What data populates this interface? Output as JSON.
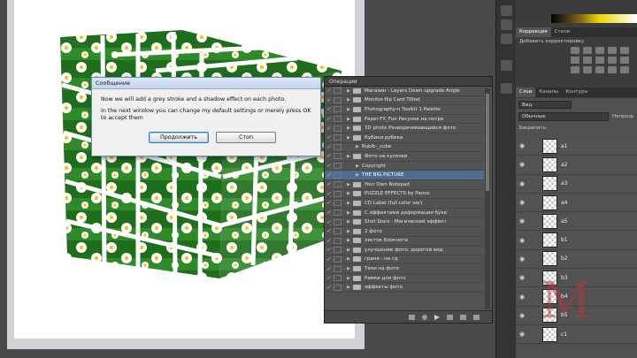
{
  "dialog": {
    "title": "Сообщение",
    "line1": "Now we will add a grey stroke and a shadow effect on each photo.",
    "line2": "In the next window you can change my default settings or merely press OK to accept them",
    "continue_label": "Продолжить",
    "stop_label": "Стоп"
  },
  "actions_panel": {
    "tab": "Операции",
    "rows": [
      {
        "label": "Магазин - Layers Down upgrade Angle",
        "type": "set",
        "sel": false
      },
      {
        "label": "Monitor-flip Card Tilted",
        "type": "set",
        "sel": false
      },
      {
        "label": "Photography-n Toolkit 1 Palette",
        "type": "set",
        "sel": false
      },
      {
        "label": "Paper-FX_Fun Рисунок на потре",
        "type": "set",
        "sel": false
      },
      {
        "label": "3D photo Разворачивающийся фото",
        "type": "set",
        "sel": false
      },
      {
        "label": "Кубики рубика",
        "type": "set",
        "sel": false
      },
      {
        "label": "Rubik-_cube",
        "type": "action",
        "sel": false
      },
      {
        "label": "Фото на кусочки",
        "type": "set",
        "sel": false
      },
      {
        "label": "Copyright",
        "type": "action",
        "sel": false
      },
      {
        "label": "THE BIG PICTURE",
        "type": "action",
        "sel": true
      },
      {
        "label": "Your Own Notepad",
        "type": "set",
        "sel": false
      },
      {
        "label": "PUZZLE EFFECTS by Panos",
        "type": "set",
        "sel": false
      },
      {
        "label": "CD Label (full color ver)",
        "type": "set",
        "sel": false
      },
      {
        "label": "С эффектами деформации букв",
        "type": "set",
        "sel": false
      },
      {
        "label": "Shot Stars - Магический эффект",
        "type": "set",
        "sel": false
      },
      {
        "label": "2 фото",
        "type": "set",
        "sel": false
      },
      {
        "label": "листок блокнота",
        "type": "set",
        "sel": false
      },
      {
        "label": "улучшение фото: дорогой вид",
        "type": "set",
        "sel": false
      },
      {
        "label": "граня - на сд",
        "type": "set",
        "sel": false
      },
      {
        "label": "Тени на фото",
        "type": "set",
        "sel": false
      },
      {
        "label": "Рамки для фото",
        "type": "set",
        "sel": false
      },
      {
        "label": "эффекты фото",
        "type": "set",
        "sel": false
      }
    ]
  },
  "right_panel": {
    "adjustments_tab": "Коррекция",
    "styles_tab": "Стили",
    "adjustments_subtitle": "Добавить корректировку",
    "layers_tab": "Слои",
    "channels_tab": "Каналы",
    "paths_tab": "Контуры",
    "kind_label": "Вид",
    "blend_mode": "Обычные",
    "opacity_label": "Непрозр",
    "lock_label": "Закрепить:",
    "layers": [
      {
        "name": "a1",
        "sel": false
      },
      {
        "name": "a2",
        "sel": false
      },
      {
        "name": "a3",
        "sel": false
      },
      {
        "name": "a4",
        "sel": false
      },
      {
        "name": "a5",
        "sel": false
      },
      {
        "name": "b1",
        "sel": false
      },
      {
        "name": "b2",
        "sel": false
      },
      {
        "name": "b3",
        "sel": false
      },
      {
        "name": "b4",
        "sel": false
      },
      {
        "name": "b5",
        "sel": false
      },
      {
        "name": "c1",
        "sel": false
      }
    ]
  },
  "watermark_text": "M",
  "colors": {
    "selection": "#4f6c92",
    "panel_bg": "#535353",
    "workspace": "#4a4a4a"
  }
}
